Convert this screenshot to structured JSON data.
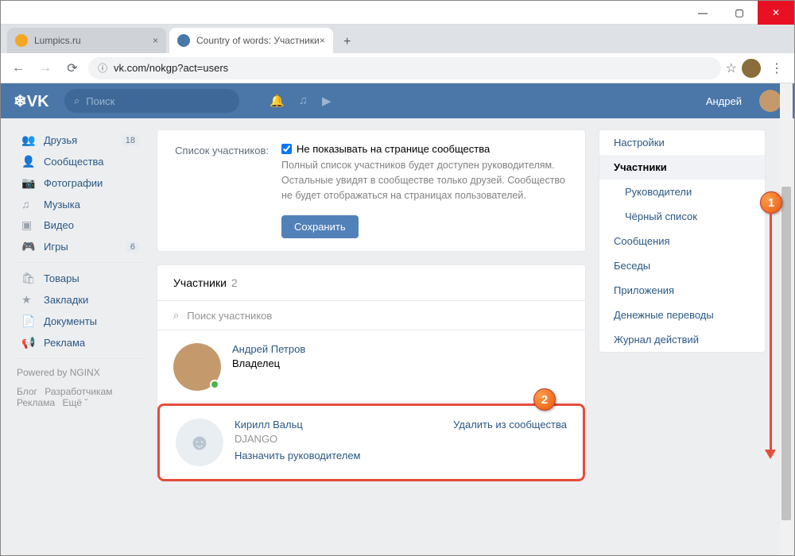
{
  "window": {
    "min": "—",
    "max": "▢",
    "close": "✕"
  },
  "tabs": {
    "t1": "Lumpics.ru",
    "t2": "Country of words: Участники",
    "plus": "+"
  },
  "addr": {
    "back": "←",
    "fwd": "→",
    "reload": "⟳",
    "url": "vk.com/nokgp?act=users",
    "star": "☆",
    "dots": "⋮"
  },
  "vkh": {
    "logo": "❄VK",
    "search_ph": "Поиск",
    "user": "Андрей"
  },
  "leftnav": {
    "items": [
      {
        "icon": "👥",
        "label": "Друзья",
        "badge": "18"
      },
      {
        "icon": "👤",
        "label": "Сообщества"
      },
      {
        "icon": "📷",
        "label": "Фотографии"
      },
      {
        "icon": "♫",
        "label": "Музыка"
      },
      {
        "icon": "▣",
        "label": "Видео"
      },
      {
        "icon": "🎮",
        "label": "Игры",
        "badge": "6"
      }
    ],
    "items2": [
      {
        "icon": "🛍",
        "label": "Товары"
      },
      {
        "icon": "★",
        "label": "Закладки"
      },
      {
        "icon": "📄",
        "label": "Документы"
      },
      {
        "icon": "📢",
        "label": "Реклама"
      }
    ],
    "powered": "Powered by NGINX",
    "foot1": "Блог",
    "foot2": "Разработчикам",
    "foot3": "Реклама",
    "foot4": "Ещё ˇ"
  },
  "settings": {
    "label": "Список участников:",
    "chk": "Не показывать на странице сообщества",
    "desc": "Полный список участников будет доступен руководителям. Остальные увидят в сообществе только друзей. Сообщество не будет отображаться на страницах пользователей.",
    "save": "Сохранить"
  },
  "members": {
    "title": "Участники",
    "count": "2",
    "search_ph": "Поиск участников",
    "m1": {
      "name": "Андрей Петров",
      "role": "Владелец"
    },
    "m2": {
      "name": "Кирилл Вальц",
      "extra": "DJANGO",
      "assign": "Назначить руководителем",
      "remove": "Удалить из сообщества"
    }
  },
  "rightnav": {
    "r1": "Настройки",
    "r2": "Участники",
    "r3": "Руководители",
    "r4": "Чёрный список",
    "r5": "Сообщения",
    "r6": "Беседы",
    "r7": "Приложения",
    "r8": "Денежные переводы",
    "r9": "Журнал действий"
  },
  "callouts": {
    "c1": "1",
    "c2": "2"
  }
}
